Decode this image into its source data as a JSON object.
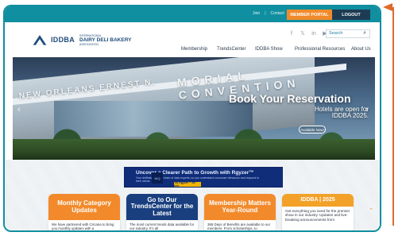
{
  "topbar": {
    "join_label": "Join",
    "separator": "|",
    "contact_label": "Contact",
    "member_portal_label": "MEMBER PORTAL",
    "logout_label": "LOGOUT"
  },
  "header": {
    "logo": {
      "acronym": "IDDBA",
      "subtext": "INTERNATIONAL",
      "name_line": "DAIRY DELI BAKERY",
      "tagline": "ASSOCIATION"
    },
    "search": {
      "placeholder": "Search"
    },
    "social_icons": [
      "facebook-icon",
      "twitter-icon",
      "linkedin-icon",
      "youtube-icon"
    ],
    "nav": [
      "Membership",
      "TrendsCenter",
      "IDDBA Show",
      "Professional Resources",
      "About Us"
    ]
  },
  "hero": {
    "sign_left": "NEW ORLEANS ERNEST N.",
    "sign_right": "MORIAL CONVENTION",
    "headline": "Book Your Reservation",
    "subheadline": "Hotels are open for IDDBA 2025.",
    "cta_label": "Available Now!"
  },
  "ad": {
    "title": "Uncover a Clearer Path to Growth with Rgyzer™",
    "subtitle": "Your deli/bakery and a team of data experts, so you understand consumer behaviors and respond to their needs.",
    "button": "Try Rgyzer™ for free",
    "logo": "NIQ"
  },
  "cards": [
    {
      "title": "Monthly Category Updates",
      "body": "We have partnered with Circana to bring you monthly updates with a"
    },
    {
      "title": "Go to Our TrendsCenter for the Latest",
      "body": "The most current trends data available for our industry. It's all"
    },
    {
      "title": "Membership Matters Year-Round",
      "body": "365 Days of Benefits are available to our members. From scholarships, to"
    },
    {
      "title": "IDDBA | 2025",
      "body": "Get everything you need for the premier show in our industry. Updates and live-breaking announcements from"
    }
  ],
  "ui_icons": {
    "hero_prev": "chevron-left-icon",
    "hero_next": "chevron-right-icon",
    "scroll_up": "chevron-up-icon",
    "search_icon": "magnifier-icon"
  },
  "colors": {
    "topbar": "#0f8fa0",
    "member_button": "#f18a2a",
    "logout_button": "#1d3b53",
    "card_orange": "#f28a2b",
    "card_navy": "#1a3f7f",
    "pointer": "#e06a2b"
  }
}
